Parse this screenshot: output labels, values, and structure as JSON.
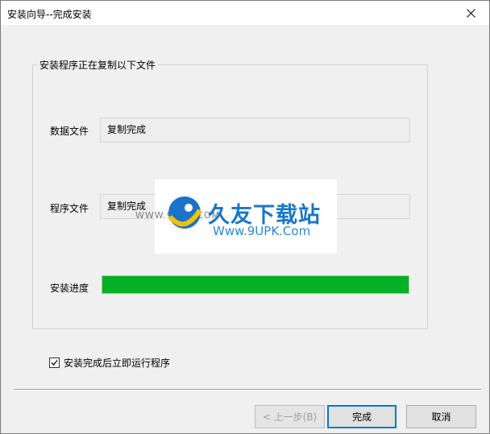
{
  "window": {
    "title": "安装向导--完成安装"
  },
  "group": {
    "legend": "安装程序正在复制以下文件",
    "rows": [
      {
        "label": "数据文件",
        "value": "复制完成"
      },
      {
        "label": "程序文件",
        "value": "复制完成"
      }
    ],
    "progress": {
      "label": "安装进度",
      "fraction": 1.0,
      "color": "#06b025"
    }
  },
  "checkbox": {
    "label": "安装完成后立即运行程序",
    "checked": true
  },
  "buttons": {
    "back": "< 上一步(B)",
    "finish": "完成",
    "cancel": "取消"
  },
  "watermark": {
    "brand": "久友下载站",
    "url": "Www.9UPK.Com",
    "faint": "WWW.9UPK.COM"
  },
  "colors": {
    "accent": "#0078d7",
    "progress": "#06b025",
    "brand": "#1877c9"
  }
}
